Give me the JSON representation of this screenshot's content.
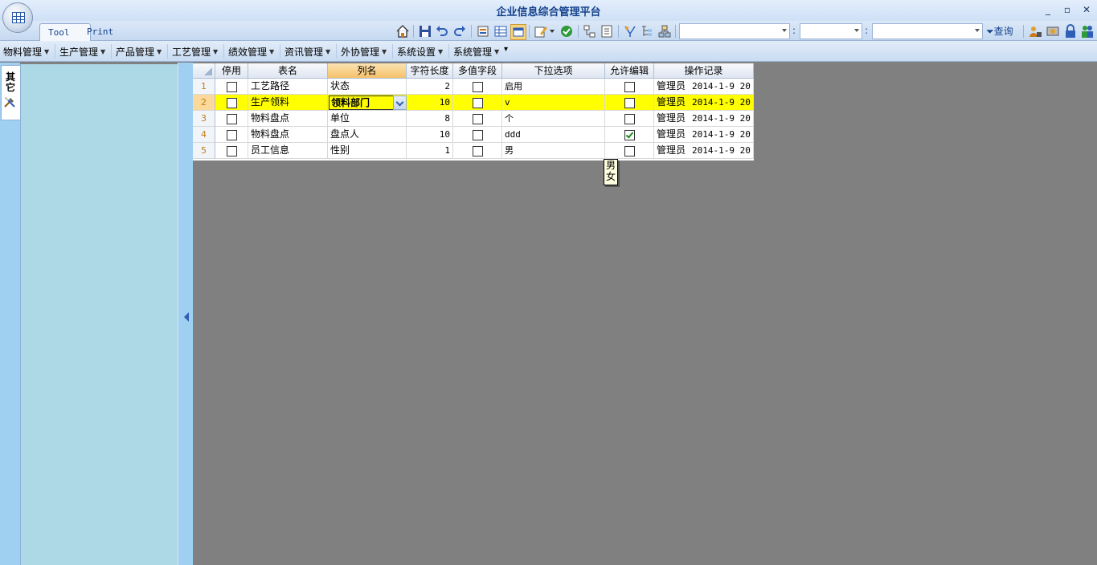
{
  "window": {
    "title": "企业信息综合管理平台"
  },
  "ribbon": {
    "tabs": [
      {
        "label": "Tool"
      },
      {
        "label": "Print"
      }
    ],
    "query_label": "查询",
    "colon": ":"
  },
  "menu": {
    "items": [
      {
        "label": "物料管理"
      },
      {
        "label": "生产管理"
      },
      {
        "label": "产品管理"
      },
      {
        "label": "工艺管理"
      },
      {
        "label": "绩效管理"
      },
      {
        "label": "资讯管理"
      },
      {
        "label": "外协管理"
      },
      {
        "label": "系统设置"
      },
      {
        "label": "系统管理"
      }
    ]
  },
  "left": {
    "tab_label": "其它",
    "tab_icon": "tools-icon"
  },
  "grid": {
    "columns": [
      "停用",
      "表名",
      "列名",
      "字符长度",
      "多值字段",
      "下拉选项",
      "允许编辑",
      "操作记录"
    ],
    "rows": [
      {
        "num": "1",
        "disabled": false,
        "table": "工艺路径",
        "column": "状态",
        "length": "2",
        "multi": false,
        "options": "启用",
        "editable": false,
        "log_user": "管理员",
        "log_time": "2014-1-9 20"
      },
      {
        "num": "2",
        "disabled": false,
        "table": "生产领料",
        "column": "领料部门",
        "length": "10",
        "multi": false,
        "options": "v",
        "editable": false,
        "log_user": "管理员",
        "log_time": "2014-1-9 20"
      },
      {
        "num": "3",
        "disabled": false,
        "table": "物料盘点",
        "column": "单位",
        "length": "8",
        "multi": false,
        "options": "个",
        "editable": false,
        "log_user": "管理员",
        "log_time": "2014-1-9 20"
      },
      {
        "num": "4",
        "disabled": false,
        "table": "物料盘点",
        "column": "盘点人",
        "length": "10",
        "multi": false,
        "options": "ddd",
        "editable": true,
        "log_user": "管理员",
        "log_time": "2014-1-9 20"
      },
      {
        "num": "5",
        "disabled": false,
        "table": "员工信息",
        "column": "性别",
        "length": "1",
        "multi": false,
        "options": "男",
        "editable": false,
        "log_user": "管理员",
        "log_time": "2014-1-9 20"
      }
    ],
    "selected_row": 2,
    "popup_options": [
      "男",
      "女"
    ]
  },
  "colors": {
    "accent": "#15428b",
    "selection": "#ffff00",
    "workspace": "#808080",
    "panel": "#add8e6"
  }
}
